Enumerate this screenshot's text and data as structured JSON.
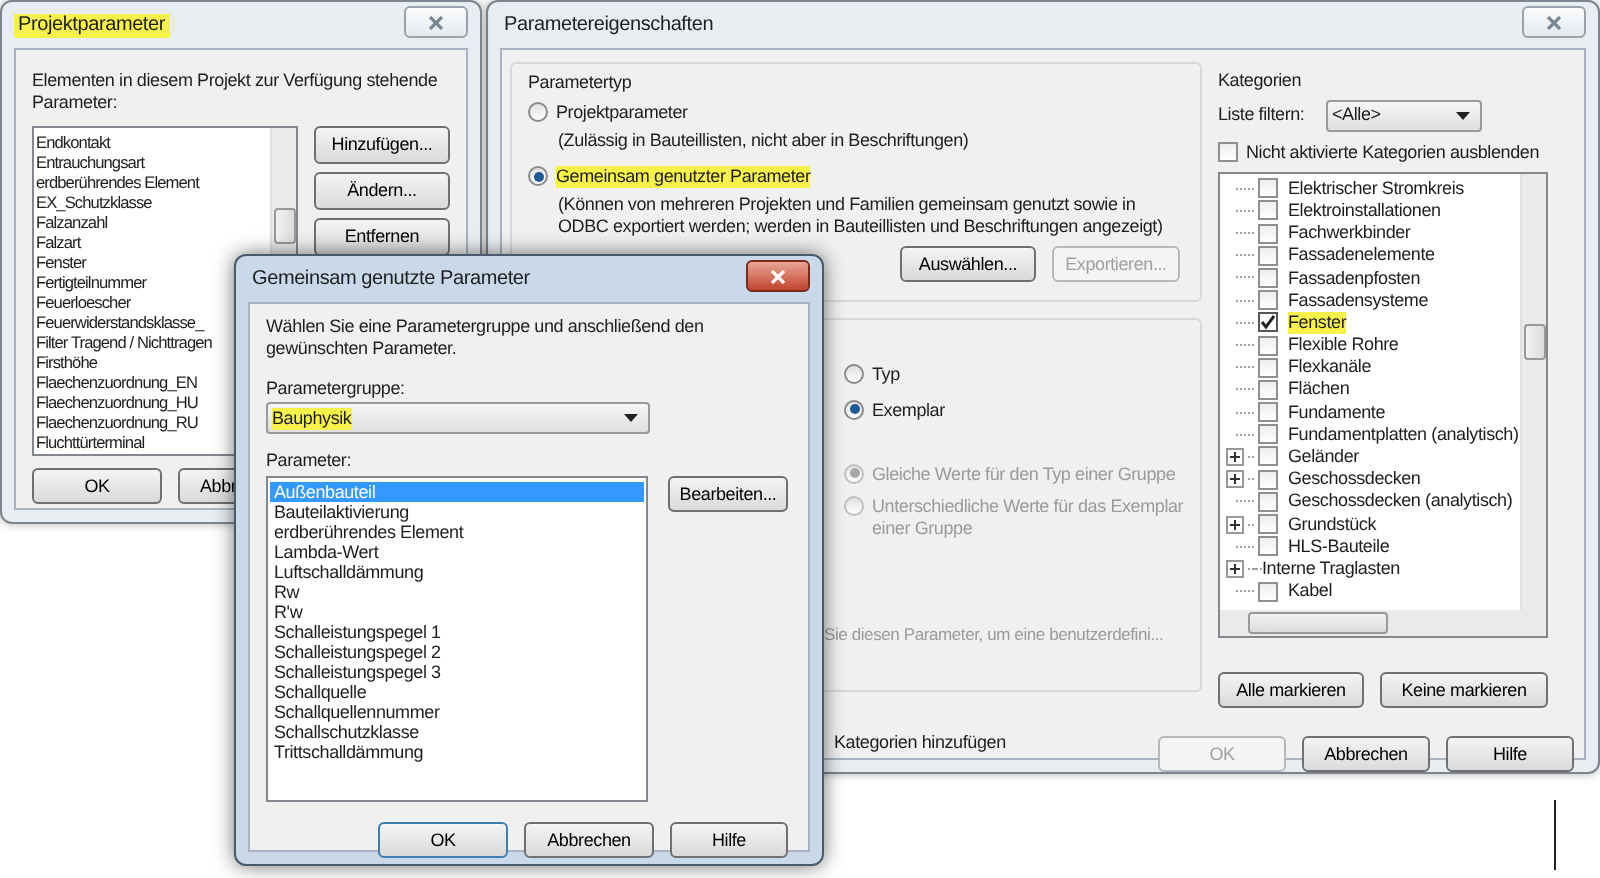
{
  "project_parameters_dialog": {
    "title": "Projektparameter",
    "title_highlighted": true,
    "description": "Elementen in diesem Projekt zur Verfügung stehende Parameter:",
    "parameters": [
      "Endkontakt",
      "Entrauchungsart",
      "erdberührendes Element",
      "EX_Schutzklasse",
      "Falzanzahl",
      "Falzart",
      "Fenster",
      "Fertigteilnummer",
      "Feuerloescher",
      "Feuerwiderstandsklasse_",
      "Filter Tragend / Nichttragen",
      "Firsthöhe",
      "Flaechenzuordnung_EN",
      "Flaechenzuordnung_HU",
      "Flaechenzuordnung_RU",
      "Fluchttürterminal"
    ],
    "side_buttons": [
      "Hinzufügen...",
      "Ändern...",
      "Entfernen"
    ],
    "footer_buttons": [
      "OK",
      "Abbr"
    ]
  },
  "parameter_properties_dialog": {
    "title": "Parametereigenschaften",
    "parameter_type": {
      "legend": "Parametertyp",
      "options": [
        {
          "label": "Projektparameter",
          "selected": false,
          "highlighted": false,
          "note": "(Zulässig in Bauteillisten, nicht aber in Beschriftungen)"
        },
        {
          "label": "Gemeinsam genutzter Parameter",
          "selected": true,
          "highlighted": true,
          "note": "(Können von mehreren Projekten und Familien gemeinsam genutzt sowie in ODBC exportiert werden; werden in Bauteillisten und Beschriftungen angezeigt)"
        }
      ],
      "buttons": [
        {
          "label": "Auswählen...",
          "disabled": false
        },
        {
          "label": "Exportieren...",
          "disabled": true
        }
      ]
    },
    "parameter_data": {
      "type_options": [
        {
          "label": "Typ",
          "selected": false
        },
        {
          "label": "Exemplar",
          "selected": true
        }
      ],
      "group_value_options": [
        {
          "label": "Gleiche Werte für den Typ einer Gruppe",
          "selected": true,
          "disabled": true
        },
        {
          "label": "Unterschiedliche Werte für das Exemplar einer Gruppe",
          "selected": false,
          "disabled": true
        }
      ],
      "hint": "Sie diesen Parameter, um eine benutzerdefini..."
    },
    "add_categories_label": "Kategorien hinzufügen",
    "categories": {
      "heading": "Kategorien",
      "filter_label": "Liste filtern:",
      "filter_value": "<Alle>",
      "hide_unchecked": {
        "label": "Nicht aktivierte Kategorien ausblenden",
        "checked": false
      },
      "items": [
        {
          "label": "Elektrischer Stromkreis",
          "kind": "checkbox",
          "checked": false,
          "expandable": false,
          "highlighted": false
        },
        {
          "label": "Elektroinstallationen",
          "kind": "checkbox",
          "checked": false,
          "expandable": false,
          "highlighted": false
        },
        {
          "label": "Fachwerkbinder",
          "kind": "checkbox",
          "checked": false,
          "expandable": false,
          "highlighted": false
        },
        {
          "label": "Fassadenelemente",
          "kind": "checkbox",
          "checked": false,
          "expandable": false,
          "highlighted": false
        },
        {
          "label": "Fassadenpfosten",
          "kind": "checkbox",
          "checked": false,
          "expandable": false,
          "highlighted": false
        },
        {
          "label": "Fassadensysteme",
          "kind": "checkbox",
          "checked": false,
          "expandable": false,
          "highlighted": false
        },
        {
          "label": "Fenster",
          "kind": "checkbox",
          "checked": true,
          "expandable": false,
          "highlighted": true
        },
        {
          "label": "Flexible Rohre",
          "kind": "checkbox",
          "checked": false,
          "expandable": false,
          "highlighted": false
        },
        {
          "label": "Flexkanäle",
          "kind": "checkbox",
          "checked": false,
          "expandable": false,
          "highlighted": false
        },
        {
          "label": "Flächen",
          "kind": "checkbox",
          "checked": false,
          "expandable": false,
          "highlighted": false
        },
        {
          "label": "Fundamente",
          "kind": "checkbox",
          "checked": false,
          "expandable": false,
          "highlighted": false
        },
        {
          "label": "Fundamentplatten (analytisch)",
          "kind": "checkbox",
          "checked": false,
          "expandable": false,
          "highlighted": false
        },
        {
          "label": "Geländer",
          "kind": "checkbox",
          "checked": false,
          "expandable": true,
          "highlighted": false
        },
        {
          "label": "Geschossdecken",
          "kind": "checkbox",
          "checked": false,
          "expandable": true,
          "highlighted": false
        },
        {
          "label": "Geschossdecken (analytisch)",
          "kind": "checkbox",
          "checked": false,
          "expandable": false,
          "highlighted": false
        },
        {
          "label": "Grundstück",
          "kind": "checkbox",
          "checked": false,
          "expandable": true,
          "highlighted": false
        },
        {
          "label": "HLS-Bauteile",
          "kind": "checkbox",
          "checked": false,
          "expandable": false,
          "highlighted": false
        },
        {
          "label": "Interne Traglasten",
          "kind": "group",
          "expandable": true,
          "highlighted": false
        },
        {
          "label": "Kabel",
          "kind": "checkbox",
          "checked": false,
          "expandable": false,
          "highlighted": false
        }
      ],
      "buttons": [
        "Alle markieren",
        "Keine markieren"
      ]
    },
    "footer_buttons": [
      {
        "label": "OK",
        "disabled": true
      },
      {
        "label": "Abbrechen",
        "disabled": false
      },
      {
        "label": "Hilfe",
        "disabled": false
      }
    ]
  },
  "shared_parameters_dialog": {
    "title": "Gemeinsam genutzte Parameter",
    "instruction": "Wählen Sie eine Parametergruppe und anschließend den gewünschten Parameter.",
    "group_label": "Parametergruppe:",
    "group_value": "Bauphysik",
    "group_highlighted": true,
    "parameter_label": "Parameter:",
    "parameters": [
      {
        "label": "Außenbauteil",
        "selected": true
      },
      {
        "label": "Bauteilaktivierung",
        "selected": false
      },
      {
        "label": "erdberührendes Element",
        "selected": false
      },
      {
        "label": "Lambda-Wert",
        "selected": false
      },
      {
        "label": "Luftschalldämmung",
        "selected": false
      },
      {
        "label": "Rw",
        "selected": false
      },
      {
        "label": "R'w",
        "selected": false
      },
      {
        "label": "Schalleistungspegel 1",
        "selected": false
      },
      {
        "label": "Schalleistungspegel 2",
        "selected": false
      },
      {
        "label": "Schalleistungspegel 3",
        "selected": false
      },
      {
        "label": "Schallquelle",
        "selected": false
      },
      {
        "label": "Schallquellennummer",
        "selected": false
      },
      {
        "label": "Schallschutzklasse",
        "selected": false
      },
      {
        "label": "Trittschalldämmung",
        "selected": false
      }
    ],
    "edit_button": "Bearbeiten...",
    "footer_buttons": [
      "OK",
      "Abbrechen",
      "Hilfe"
    ]
  }
}
